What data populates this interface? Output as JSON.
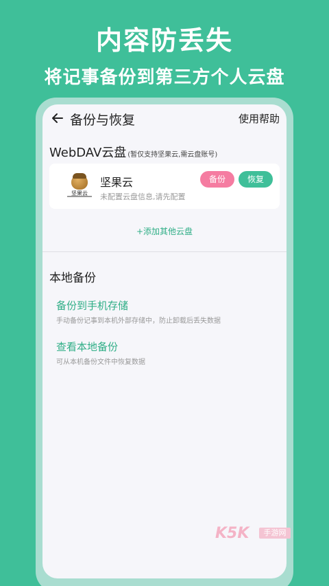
{
  "promo": {
    "headline": "内容防丢失",
    "subline": "将记事备份到第三方个人云盘"
  },
  "topbar": {
    "title": "备份与恢复",
    "help": "使用帮助"
  },
  "webdav": {
    "title": "WebDAV云盘",
    "note": "(暂仅支持坚果云,需云盘账号)",
    "service": {
      "logo_text": "坚果云",
      "name": "坚果云",
      "desc": "未配置云盘信息,请先配置",
      "backup_label": "备份",
      "restore_label": "恢复"
    },
    "add_label": "+添加其他云盘"
  },
  "local": {
    "title": "本地备份",
    "items": [
      {
        "title": "备份到手机存储",
        "desc": "手动备份记事到本机外部存储中，防止卸载后丢失数据"
      },
      {
        "title": "查看本地备份",
        "desc": "可从本机备份文件中恢复数据"
      }
    ]
  },
  "watermark": {
    "brand": "K5K",
    "box_text": "手游网"
  },
  "colors": {
    "accent": "#3fbf99",
    "accent_text": "#2fae86",
    "backup_pink": "#f57ca1"
  }
}
